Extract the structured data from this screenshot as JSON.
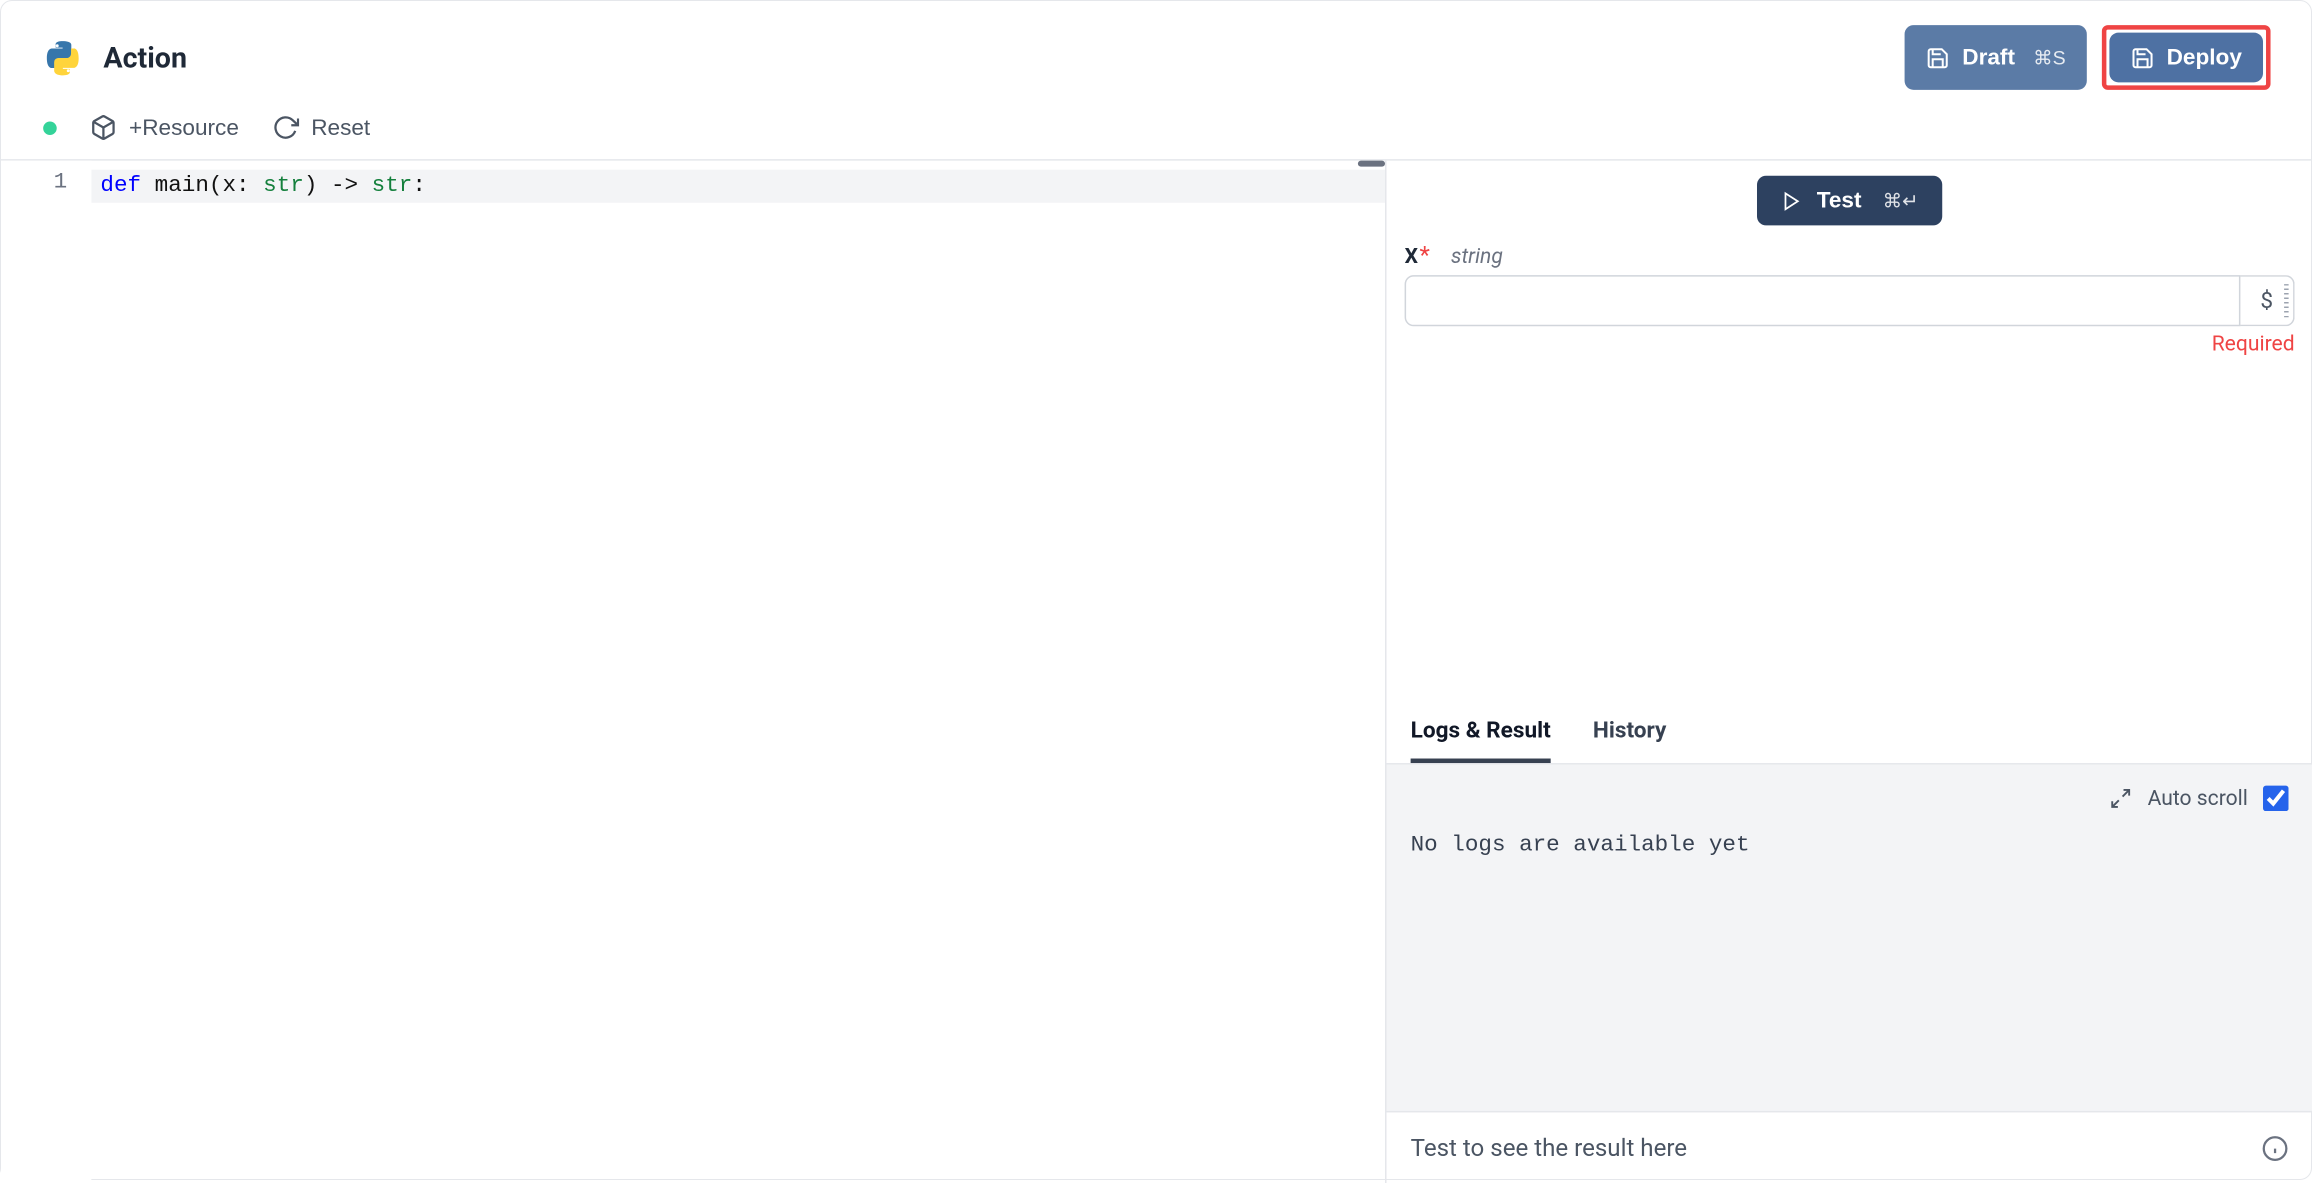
{
  "header": {
    "title": "Action",
    "draft_label": "Draft",
    "draft_shortcut": "⌘S",
    "deploy_label": "Deploy"
  },
  "toolbar": {
    "resource_label": "+Resource",
    "reset_label": "Reset"
  },
  "editor": {
    "line_numbers": [
      "1"
    ],
    "code": {
      "kw_def": "def",
      "fn_name": "main",
      "param_open": "(x: ",
      "type1": "str",
      "param_close": ")",
      "arrow": " -> ",
      "type2": "str",
      "colon": ":"
    }
  },
  "test": {
    "button_label": "Test",
    "shortcut": "⌘↵",
    "param_name": "X",
    "param_type": "string",
    "required_label": "Required",
    "variable_symbol": "$"
  },
  "tabs": {
    "logs_result": "Logs & Result",
    "history": "History"
  },
  "logs": {
    "auto_scroll_label": "Auto scroll",
    "empty_message": "No logs are available yet"
  },
  "result": {
    "placeholder": "Test to see the result here"
  }
}
